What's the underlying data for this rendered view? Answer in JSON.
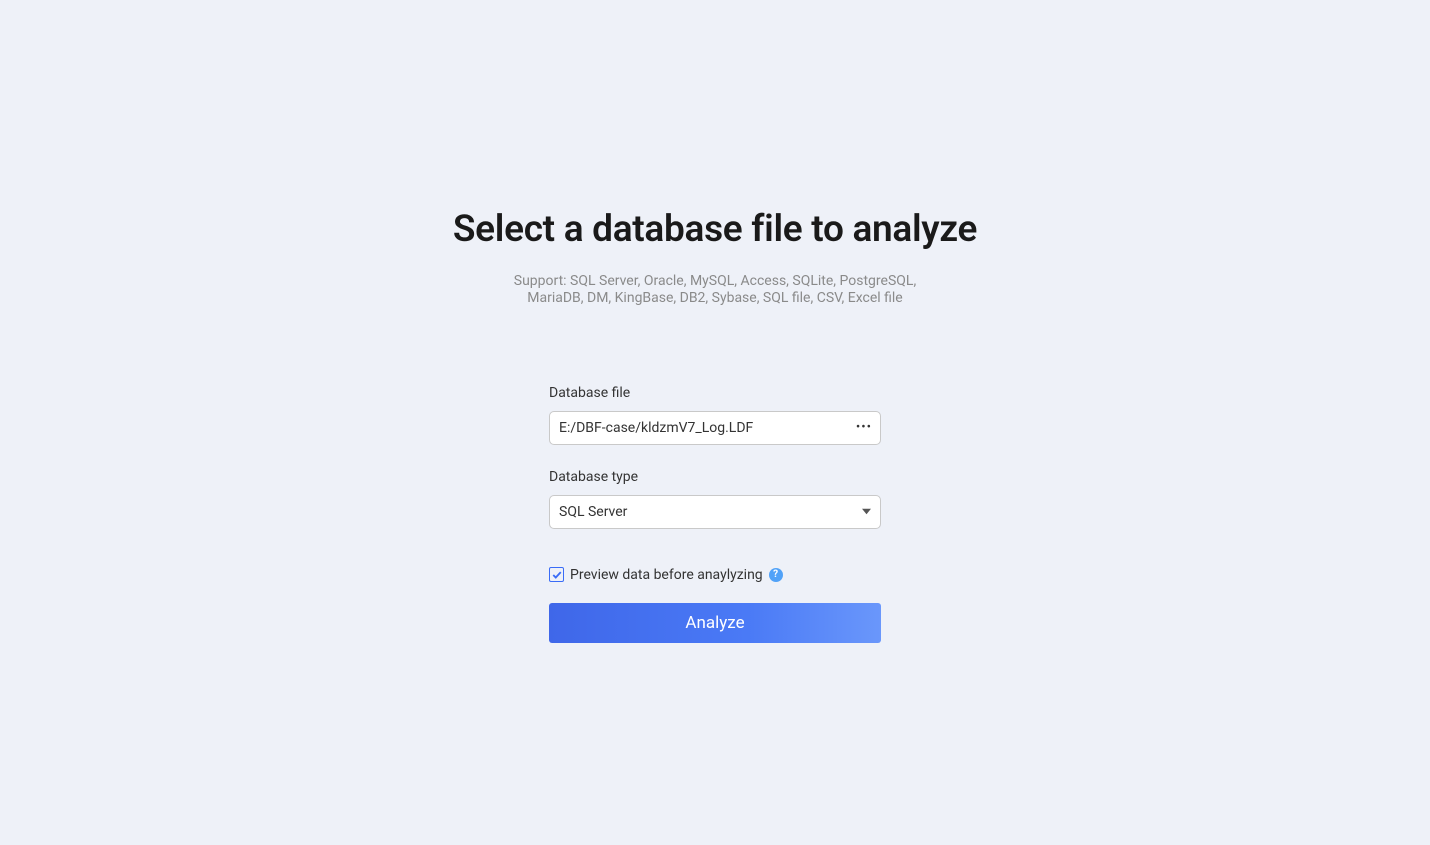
{
  "header": {
    "title": "Select a database file to analyze",
    "subtitle": "Support: SQL Server, Oracle, MySQL, Access, SQLite, PostgreSQL, MariaDB, DM, KingBase, DB2, Sybase, SQL file, CSV, Excel file"
  },
  "form": {
    "database_file": {
      "label": "Database file",
      "value": "E:/DBF-case/kldzmV7_Log.LDF"
    },
    "database_type": {
      "label": "Database type",
      "selected": "SQL Server"
    },
    "preview_checkbox": {
      "checked": true,
      "label": "Preview data before anaylyzing"
    },
    "help_icon_label": "?",
    "analyze_button_label": "Analyze"
  }
}
